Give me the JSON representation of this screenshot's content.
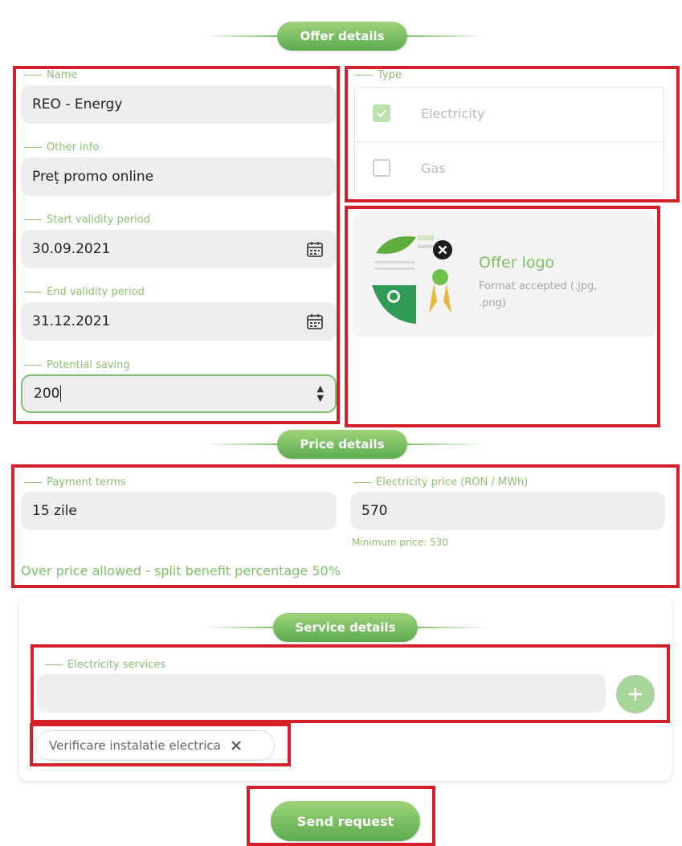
{
  "sections": {
    "offer_details": "Offer details",
    "price_details": "Price details",
    "service_details": "Service details"
  },
  "offer": {
    "name_label": "Name",
    "name_value": "REO - Energy",
    "other_info_label": "Other info",
    "other_info_value": "Preț promo online",
    "start_label": "Start validity period",
    "start_value": "30.09.2021",
    "end_label": "End validity period",
    "end_value": "31.12.2021",
    "saving_label": "Potential saving",
    "saving_value": "200"
  },
  "type": {
    "label": "Type",
    "options": [
      {
        "label": "Electricity",
        "checked": true
      },
      {
        "label": "Gas",
        "checked": false
      }
    ]
  },
  "logo": {
    "title": "Offer logo",
    "hint": "Format accepted (.jpg, .png)"
  },
  "price": {
    "payment_terms_label": "Payment terms",
    "payment_terms_value": "15 zile",
    "electricity_price_label": "Electricity price (RON / MWh)",
    "electricity_price_value": "570",
    "minimum_price": "Minimum price: 530",
    "over_price_note": "Over price allowed - split benefit percentage 50%"
  },
  "services": {
    "label": "Electricity services",
    "value": "",
    "chips": [
      "Verificare instalatie electrica"
    ]
  },
  "actions": {
    "send_label": "Send request"
  },
  "colors": {
    "accent": "#6cba55",
    "highlight_border": "#d4202a",
    "field_bg": "#ededed"
  }
}
